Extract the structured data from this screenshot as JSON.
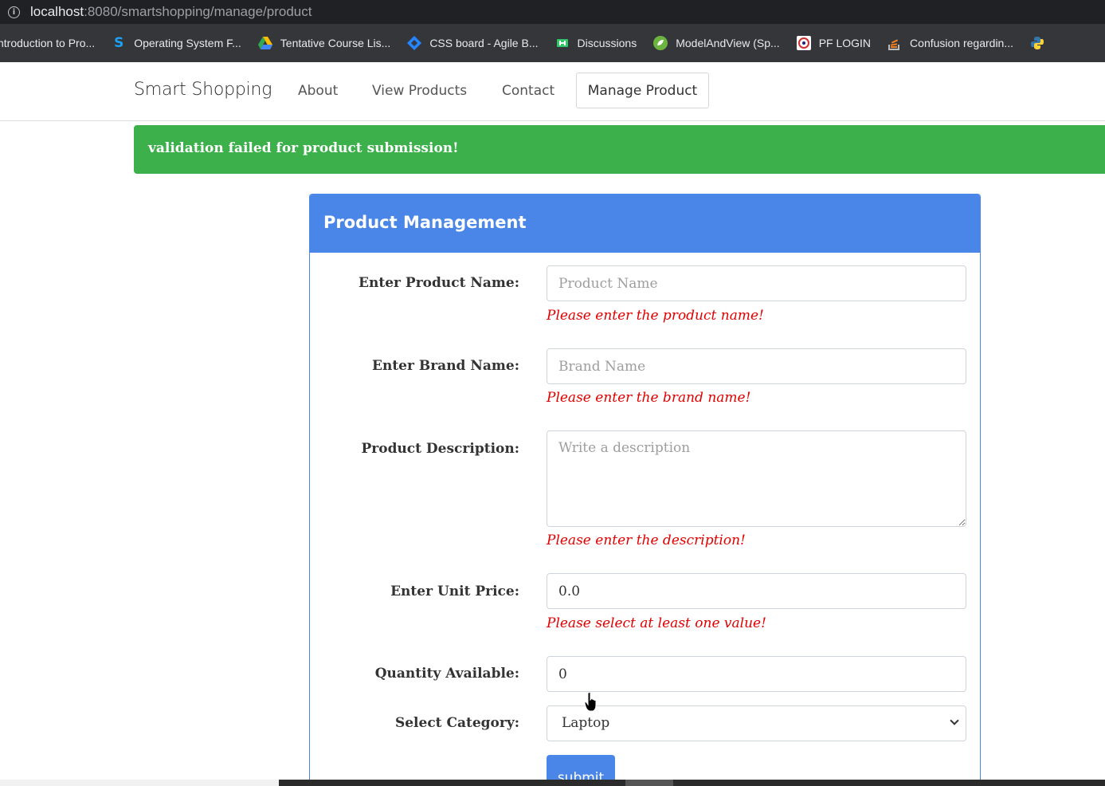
{
  "browser": {
    "url_host": "localhost",
    "url_rest": ":8080/smartshopping/manage/product"
  },
  "bookmarks": [
    {
      "label": "ntroduction to Pro...",
      "icon": "none",
      "color": "#e8eaed"
    },
    {
      "label": "Operating System F...",
      "icon": "S",
      "color": "#1da1f2"
    },
    {
      "label": "Tentative Course Lis...",
      "icon": "google-drive-icon",
      "color": "#fbbc04"
    },
    {
      "label": "CSS board - Agile B...",
      "icon": "jira-icon",
      "color": "#2684ff"
    },
    {
      "label": "Discussions",
      "icon": "hackerrank-icon",
      "color": "#2ec866"
    },
    {
      "label": "ModelAndView (Sp...",
      "icon": "spring-icon",
      "color": "#6db33f"
    },
    {
      "label": "PF LOGIN",
      "icon": "epfo-icon",
      "color": "#d32f2f"
    },
    {
      "label": "Confusion regardin...",
      "icon": "stackoverflow-icon",
      "color": "#f48024"
    },
    {
      "label": "",
      "icon": "python-icon",
      "color": "#3776ab"
    }
  ],
  "navbar": {
    "brand": "Smart Shopping",
    "links": [
      "About",
      "View Products",
      "Contact"
    ],
    "active": "Manage Product"
  },
  "alert": "validation failed for product submission!",
  "panel": {
    "title": "Product Management",
    "product_name_label": "Enter Product Name:",
    "product_name_placeholder": "Product Name",
    "product_name_error": "Please enter the product name!",
    "brand_name_label": "Enter Brand Name:",
    "brand_name_placeholder": "Brand Name",
    "brand_name_error": "Please enter the brand name!",
    "description_label": "Product Description:",
    "description_placeholder": "Write a description",
    "description_error": "Please enter the description!",
    "unit_price_label": "Enter Unit Price:",
    "unit_price_value": "0.0",
    "unit_price_error": "Please select at least one value!",
    "quantity_label": "Quantity Available:",
    "quantity_value": "0",
    "category_label": "Select Category:",
    "category_value": "Laptop",
    "submit_label": "submit"
  },
  "colors": {
    "accent": "#4a86e8",
    "alert_green": "#3cb04a",
    "error_red": "#e00000"
  }
}
